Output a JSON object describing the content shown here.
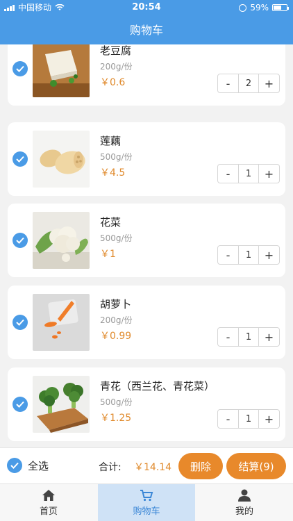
{
  "status_bar": {
    "carrier": "中国移动",
    "time": "20:54",
    "battery": "59%",
    "battery_level": 0.59
  },
  "header": {
    "title": "购物车"
  },
  "colors": {
    "primary": "#4a9be6",
    "accent": "#e8892b",
    "price": "#e08a2c"
  },
  "items": [
    {
      "name": "老豆腐",
      "spec": "200g/份",
      "price": "￥0.6",
      "qty": "2",
      "checked": true,
      "image": "tofu"
    },
    {
      "name": "莲藕",
      "spec": "500g/份",
      "price": "￥4.5",
      "qty": "1",
      "checked": true,
      "image": "lotus-root"
    },
    {
      "name": "花菜",
      "spec": "500g/份",
      "price": "￥1",
      "qty": "1",
      "checked": true,
      "image": "cauliflower"
    },
    {
      "name": "胡萝卜",
      "spec": "200g/份",
      "price": "￥0.99",
      "qty": "1",
      "checked": true,
      "image": "carrot"
    },
    {
      "name": "青花（西兰花、青花菜）",
      "spec": "500g/份",
      "price": "￥1.25",
      "qty": "1",
      "checked": true,
      "image": "broccoli"
    }
  ],
  "stepper": {
    "minus": "-",
    "plus": "+"
  },
  "summary": {
    "select_all": "全选",
    "total_label": "合计:",
    "total_value": "￥14.14",
    "delete": "删除",
    "checkout": "结算(9)"
  },
  "tabs": [
    {
      "label": "首页",
      "icon": "home-icon"
    },
    {
      "label": "购物车",
      "icon": "cart-icon",
      "active": true
    },
    {
      "label": "我的",
      "icon": "user-icon"
    }
  ]
}
